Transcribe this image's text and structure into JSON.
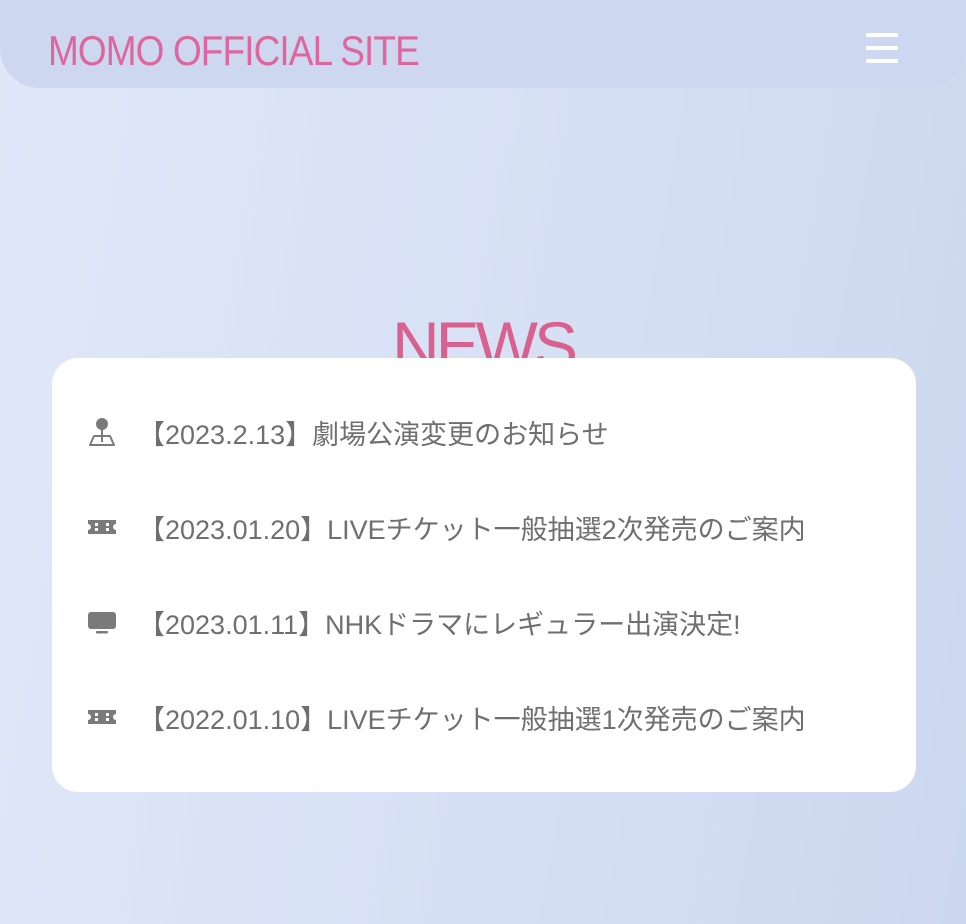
{
  "header": {
    "site_title": "MOMO OFFICIAL SITE",
    "menu_icon": "hamburger-menu-icon"
  },
  "news": {
    "title": "NEWS",
    "items": [
      {
        "icon": "map-pin-icon",
        "text": "【2023.2.13】劇場公演変更のお知らせ"
      },
      {
        "icon": "ticket-icon",
        "text": "【2023.01.20】LIVEチケット一般抽選2次発売のご案内"
      },
      {
        "icon": "tv-icon",
        "text": "【2023.01.11】NHKドラマにレギュラー出演決定!"
      },
      {
        "icon": "ticket-icon",
        "text": "【2022.01.10】LIVEチケット一般抽選1次発売のご案内"
      }
    ]
  },
  "colors": {
    "accent_pink": "#dd669f",
    "header_bg": "#cdd7ef",
    "page_bg": "#d8e1f5",
    "card_bg": "#ffffff",
    "text_gray": "#6f6f6f",
    "icon_gray": "#7a7a7a"
  }
}
